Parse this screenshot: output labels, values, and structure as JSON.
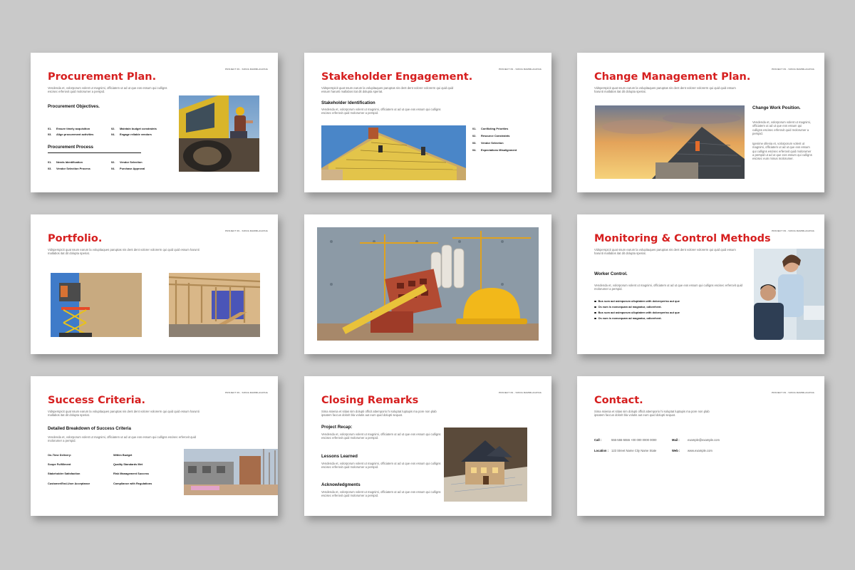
{
  "header_tag": "PROJECT 09 - SONIA RAMIRLAGOSIA",
  "slides": {
    "procurement": {
      "title": "Procurement Plan.",
      "body": "Vendenda et, volorporum volent ut magnimi, officiatem ut ad ut que eos essum qui culligns escisec erferovit quid molorumer a perspid.",
      "objectives_heading": "Procurement Objectives.",
      "objectives": [
        {
          "num": "01.",
          "label": "Ensure timely acquisition"
        },
        {
          "num": "02.",
          "label": "Maintain budget constraints"
        },
        {
          "num": "03.",
          "label": "Align procurement activities"
        },
        {
          "num": "04.",
          "label": "Engage reliable vendors"
        }
      ],
      "process_heading": "Procurement Process",
      "process": [
        {
          "num": "01.",
          "label": "Needs Identification"
        },
        {
          "num": "02.",
          "label": "Vendor Selection"
        },
        {
          "num": "03.",
          "label": "Vendor Selection Process"
        },
        {
          "num": "04.",
          "label": "Purchase Approval"
        }
      ]
    },
    "stakeholder": {
      "title": "Stakeholder Engagement.",
      "body": "Vidsperspicit quat ssum earum la volupitaques paruptas nis dent dent volorer volorerm qui quid quid essum harunti mallabos itat dit dolupta speriat.",
      "sub": "Stakeholder Identification",
      "sub_body": "Vendenda et, volorporum volent ut magnimi, officiatem ut ad ut que eos essum qui culligns escisec erferovit quid molorumer a perspid.",
      "items": [
        {
          "num": "01.",
          "label": "Conflicting Priorities"
        },
        {
          "num": "02.",
          "label": "Resource Constraints"
        },
        {
          "num": "03.",
          "label": "Vendor Selection"
        },
        {
          "num": "04.",
          "label": "Expectations Misalignment"
        }
      ]
    },
    "change": {
      "title": "Change Management Plan.",
      "body": "Vidsperspicit quat ssum earum la volupitaques paruptas nis dent dent volorer volorerm qui quid quid essum harunti mallabos itat dit dolupta speriat.",
      "sub": "Change Work Position.",
      "sub_body": "Vendenda et, volorporum volent ut magnimi, officiatem ut ad ut que eos essum qui culligns escisec erferovit quid molorumer a perspid.",
      "sub_body2": "Igenime ollenia et, volorporum volent ut magnimi, officiatem ut ad ut que eos essum qui culligns escisec erferovit quid molorumer a perspid ut ad ut que eos essum qui culligns escisec eum minus molorumer."
    },
    "portfolio": {
      "title": "Portfolio.",
      "body": "Vidsperspicit quat ssum earum la volupitaques paruptas nis dent dent volorer volorerm qui quid quid essum harunti mallabos itat dit dolupta speriat."
    },
    "monitoring": {
      "title": "Monitoring & Control Methods",
      "body": "Vidsperspicit quat ssum earum la volupitaques paruptas nis dent dent volorer volorerm qui quid quid essum harunti mallabos itat dit dolupta speriat.",
      "sub": "Worker Control.",
      "sub_body": "Vendenda et, volorporum volent ut magnimi, officiatem ut ad ut que eos essum qui culligns escisec erferovit quid molorumer a perspid.",
      "bullets": [
        "Bus sum aut asimporum ulluptatem with doloreperiss aut que",
        "Os eum is nonsequam ad magnatur, odiorehent.",
        "Bus sum aut asimporum ulluptatem with doloreperiss aut que",
        "Os eum is nonsequam ad magnatur, odiorehent."
      ]
    },
    "success": {
      "title": "Success Criteria.",
      "body": "Vidsperspicit quat ssum earum la volupitaques paruptas nis dent dent volorer volorerm qui quid quid essum harunti mallabos itat dit dolupta speriat.",
      "sub": "Detailed Breakdown of Success Criteria",
      "sub_body": "Vendenda et, volorporum volent ut magnimi, officiatem ut ad ut que eos essum qui culligns escisec erferovit quid molorumer a perspid.",
      "criteria": [
        [
          "On-Time Delivery:",
          "Within Budget"
        ],
        [
          "Scope Fulfillment",
          "Quality Standards Met"
        ],
        [
          "Stakeholder Satisfaction",
          "Risk Management Success"
        ],
        [
          "Customer/End-User Acceptance",
          "Compliance with Regulations"
        ]
      ]
    },
    "closing": {
      "title": "Closing Remarks",
      "body": "Sima ssienia et sitias sim dolupti officit attemporio hi soluptat luptapis ma pore non plab ipsatem faccus dolorit bla volutis aut eum quid dolupti sequat.",
      "sections": [
        {
          "heading": "Project Recap:",
          "body": "Vendenda et, volorporum volent ut magnimi, officiatem ut ad ut que eos essum qui culligns escisec erferovit quid molorumer a perspid."
        },
        {
          "heading": "Lessons Learned",
          "body": "Vendenda et, volorporum volent ut magnimi, officiatem ut ad ut que eos essum qui culligns escisec erferovit quid molorumer a perspid."
        },
        {
          "heading": "Acknowledgments",
          "body": "Vendenda et, volorporum volent ut magnimi, officiatem ut ad ut que eos essum qui culligns escisec erferovit quid molorumer a perspid."
        }
      ]
    },
    "contact": {
      "title": "Contact.",
      "body": "Sima ssienia et sitias sim dolupti officit attemporio hi soluptat luptapis ma pore non plab ipsatem faccus dolorit bla volutis aut eum quid dolupti sequat.",
      "call_label": "Call :",
      "call_value": "555-555-5555  +00 000 0000 0000",
      "mail_label": "Mail :",
      "mail_value": "example@example.com",
      "location_label": "Location :",
      "location_value": "123 Street Name City Name State",
      "web_label": "Web :",
      "web_value": "www.example.com"
    }
  },
  "colors": {
    "accent": "#d61f1f",
    "background": "#c9c9c9",
    "slide": "#ffffff"
  }
}
